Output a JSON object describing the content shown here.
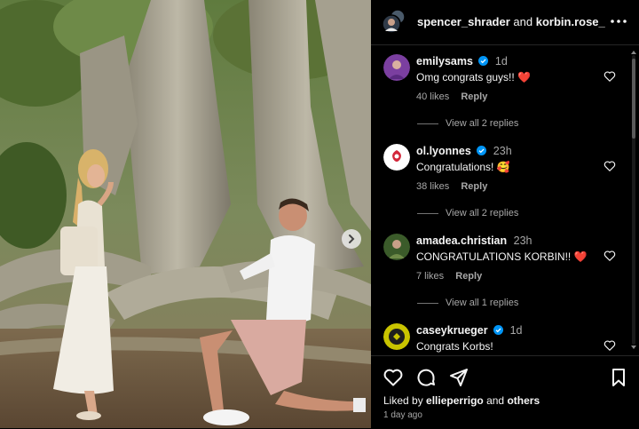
{
  "header": {
    "user1": "spencer_shrader",
    "and": "and",
    "user2": "korbin.rose_",
    "more_icon": "more-horizontal-icon"
  },
  "comments": [
    {
      "username": "emilysams",
      "verified": true,
      "time": "1d",
      "text": "Omg congrats guys!!",
      "emoji": "❤️",
      "likes": "40 likes",
      "reply": "Reply",
      "view_replies": "View all 2 replies",
      "avatar_color": "#7b3fa0"
    },
    {
      "username": "ol.lyonnes",
      "verified": true,
      "time": "23h",
      "text": "Congratulations!",
      "emoji": "🥰",
      "likes": "38 likes",
      "reply": "Reply",
      "view_replies": "View all 2 replies",
      "avatar_color": "#ffffff"
    },
    {
      "username": "amadea.christian",
      "verified": false,
      "time": "23h",
      "text": "CONGRATULATIONS KORBIN!!",
      "emoji": "❤️",
      "likes": "7 likes",
      "reply": "Reply",
      "view_replies": "View all 1 replies",
      "avatar_color": "#3b5b2a"
    },
    {
      "username": "caseykrueger",
      "verified": true,
      "time": "1d",
      "text": "Congrats Korbs!",
      "emoji": "",
      "likes": "",
      "reply": "",
      "view_replies": "",
      "avatar_color": "#c9c400"
    }
  ],
  "footer": {
    "liked_prefix": "Liked by",
    "liked_user": "ellieperrigo",
    "liked_and": "and",
    "liked_others": "others",
    "time_ago": "1 day ago",
    "icons": [
      "heart-icon",
      "comment-icon",
      "share-icon",
      "bookmark-icon"
    ]
  },
  "colors": {
    "background": "#000000",
    "text": "#f5f5f5",
    "muted": "#a8a8a8",
    "verified": "#0095f6",
    "heart": "#ff3040"
  }
}
